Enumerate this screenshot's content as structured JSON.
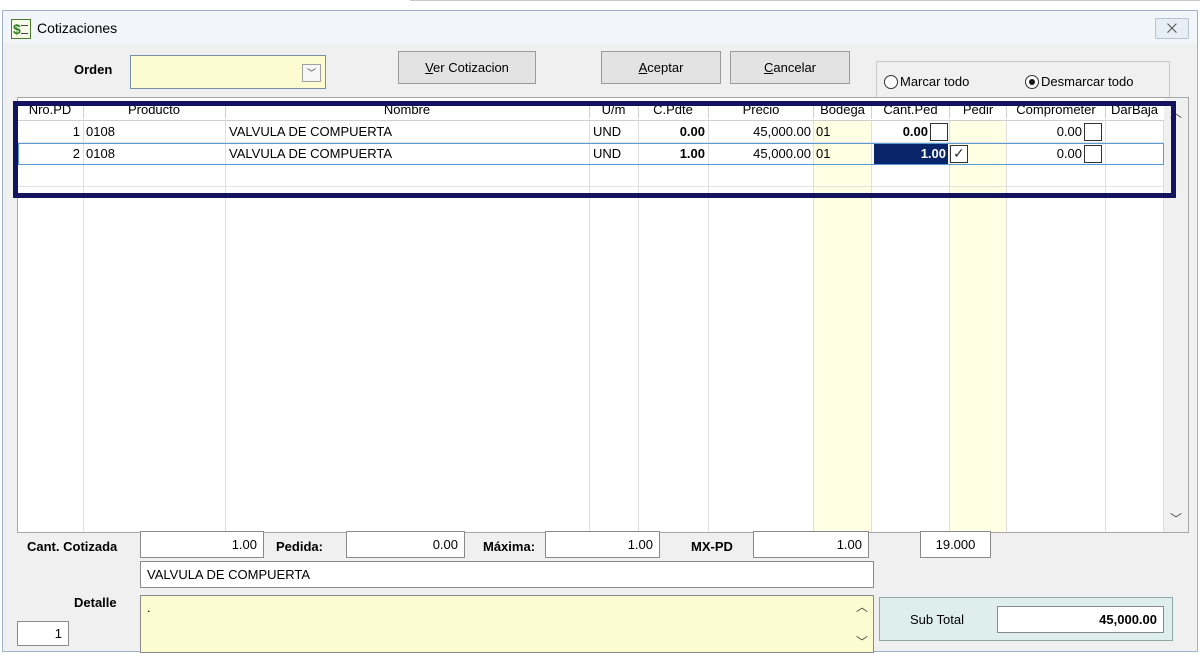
{
  "window": {
    "title": "Cotizaciones",
    "close_label": "⨉"
  },
  "toolbar": {
    "orden_label": "Orden",
    "orden_value": "",
    "ver_cotizacion_label": "Ver Cotizacion",
    "ver_cotizacion_hotkey": "V",
    "ver_cotizacion_rest": "er Cotizacion",
    "aceptar_hotkey": "A",
    "aceptar_rest": "ceptar",
    "cancelar_hotkey": "C",
    "cancelar_rest": "ancelar",
    "marcar_todo": "Marcar todo",
    "desmarcar_todo": "Desmarcar todo",
    "selected_option": "desmarcar"
  },
  "grid": {
    "columns": [
      "Nro.PD",
      "Producto",
      "Nombre",
      "U/m",
      "C.Pdte",
      "Precio",
      "Bodega",
      "Cant.Ped",
      "Pedir",
      "Comprometer",
      "DarBaja"
    ],
    "rows": [
      {
        "nro": "1",
        "producto": "0108",
        "nombre": "VALVULA DE COMPUERTA",
        "um": "UND",
        "cpdte": "0.00",
        "precio": "45,000.00",
        "bodega": "01",
        "cantped": "0.00",
        "pedir": false,
        "comprometer": "0.00",
        "darbaja": false
      },
      {
        "nro": "2",
        "producto": "0108",
        "nombre": "VALVULA DE COMPUERTA",
        "um": "UND",
        "cpdte": "1.00",
        "precio": "45,000.00",
        "bodega": "01",
        "cantped": "1.00",
        "pedir": true,
        "comprometer": "0.00",
        "darbaja": false
      }
    ]
  },
  "footer": {
    "cant_cotizada_label": "Cant. Cotizada",
    "cant_cotizada_value": "1.00",
    "pedida_label": "Pedida:",
    "pedida_value": "0.00",
    "maxima_label": "Máxima:",
    "maxima_value": "1.00",
    "mxpd_label": "MX-PD",
    "mxpd_value": "1.00",
    "extra_value": "19.000",
    "product_name": "VALVULA DE COMPUERTA",
    "detalle_label": "Detalle",
    "detalle_value": ".",
    "line_number": "1",
    "subtotal_label": "Sub Total",
    "subtotal_value": "45,000.00"
  }
}
